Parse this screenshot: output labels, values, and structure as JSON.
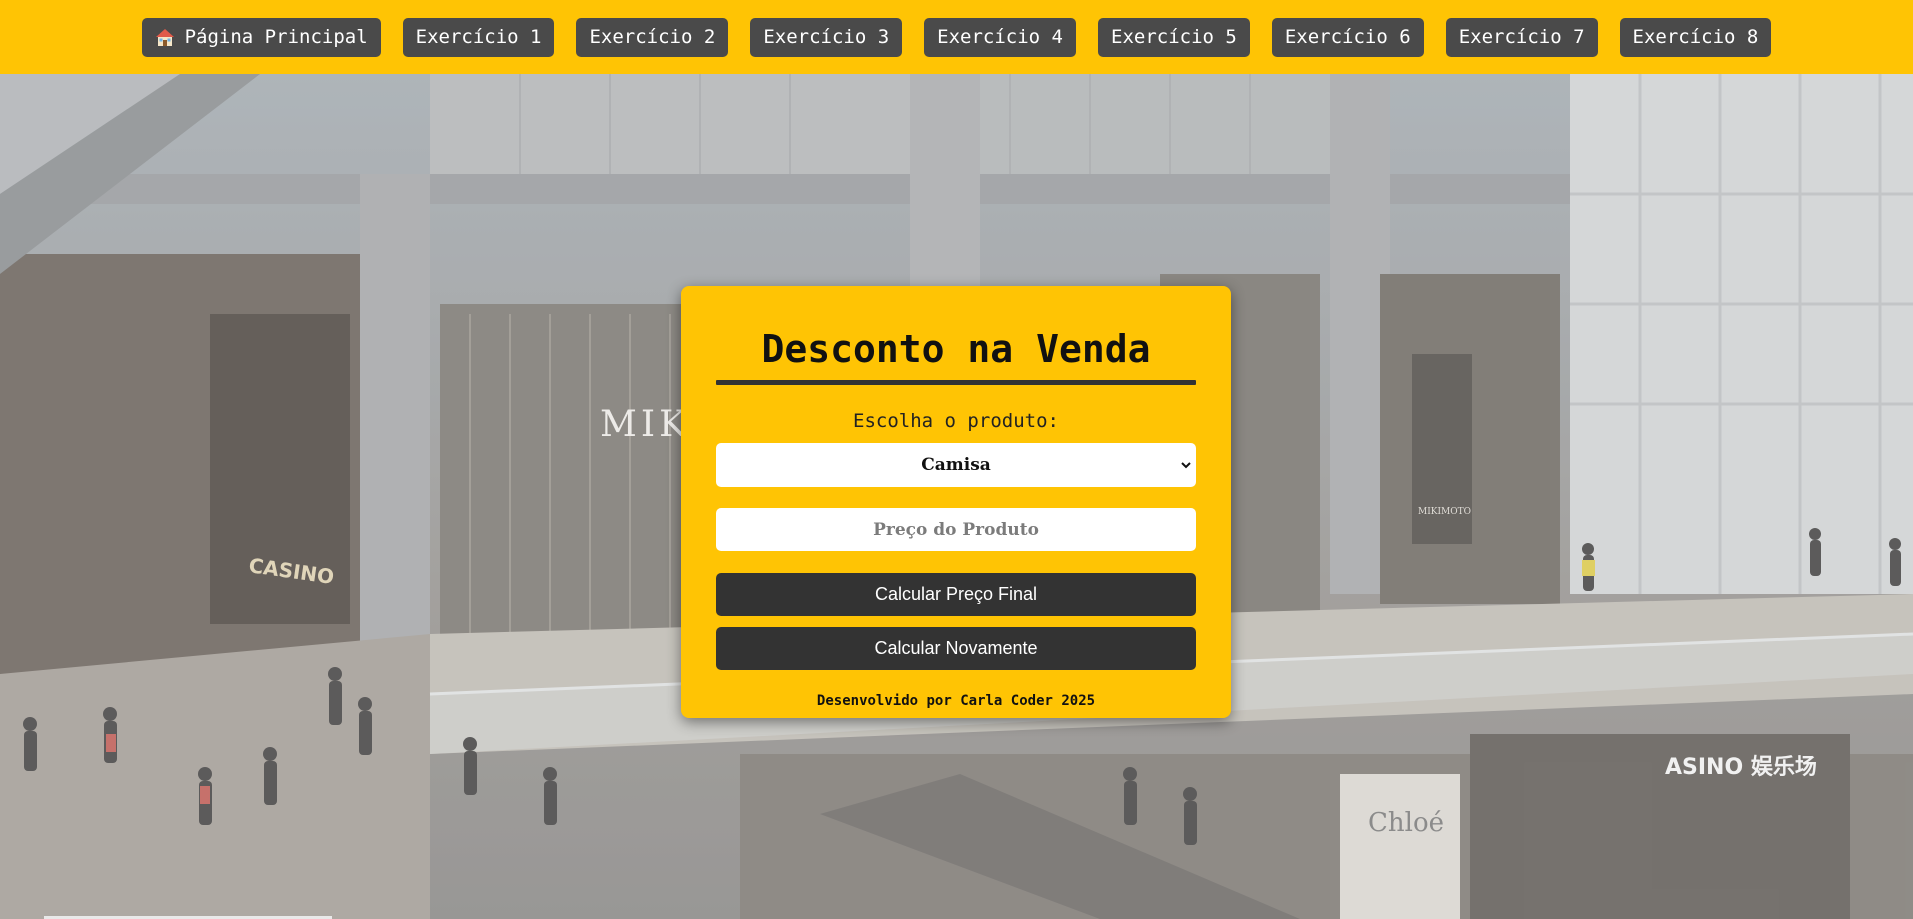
{
  "nav": {
    "home_label": "Página Principal",
    "items": [
      {
        "label": "Exercício 1"
      },
      {
        "label": "Exercício 2"
      },
      {
        "label": "Exercício 3"
      },
      {
        "label": "Exercício 4"
      },
      {
        "label": "Exercício 5"
      },
      {
        "label": "Exercício 6"
      },
      {
        "label": "Exercício 7"
      },
      {
        "label": "Exercício 8"
      }
    ]
  },
  "card": {
    "title": "Desconto na Venda",
    "product_label": "Escolha o produto:",
    "product_selected": "Camisa",
    "price_placeholder": "Preço do Produto",
    "calc_button": "Calcular Preço Final",
    "again_button": "Calcular Novamente",
    "footer": "Desenvolvido por Carla Coder 2025"
  },
  "background": {
    "signage": [
      "MIK",
      "CASINO",
      "MIKIMOTO",
      "Chloé",
      "ASINO 娱乐场"
    ]
  },
  "colors": {
    "accent_yellow": "#ffc404",
    "button_dark": "#333333",
    "nav_button": "#4a4a4a"
  }
}
